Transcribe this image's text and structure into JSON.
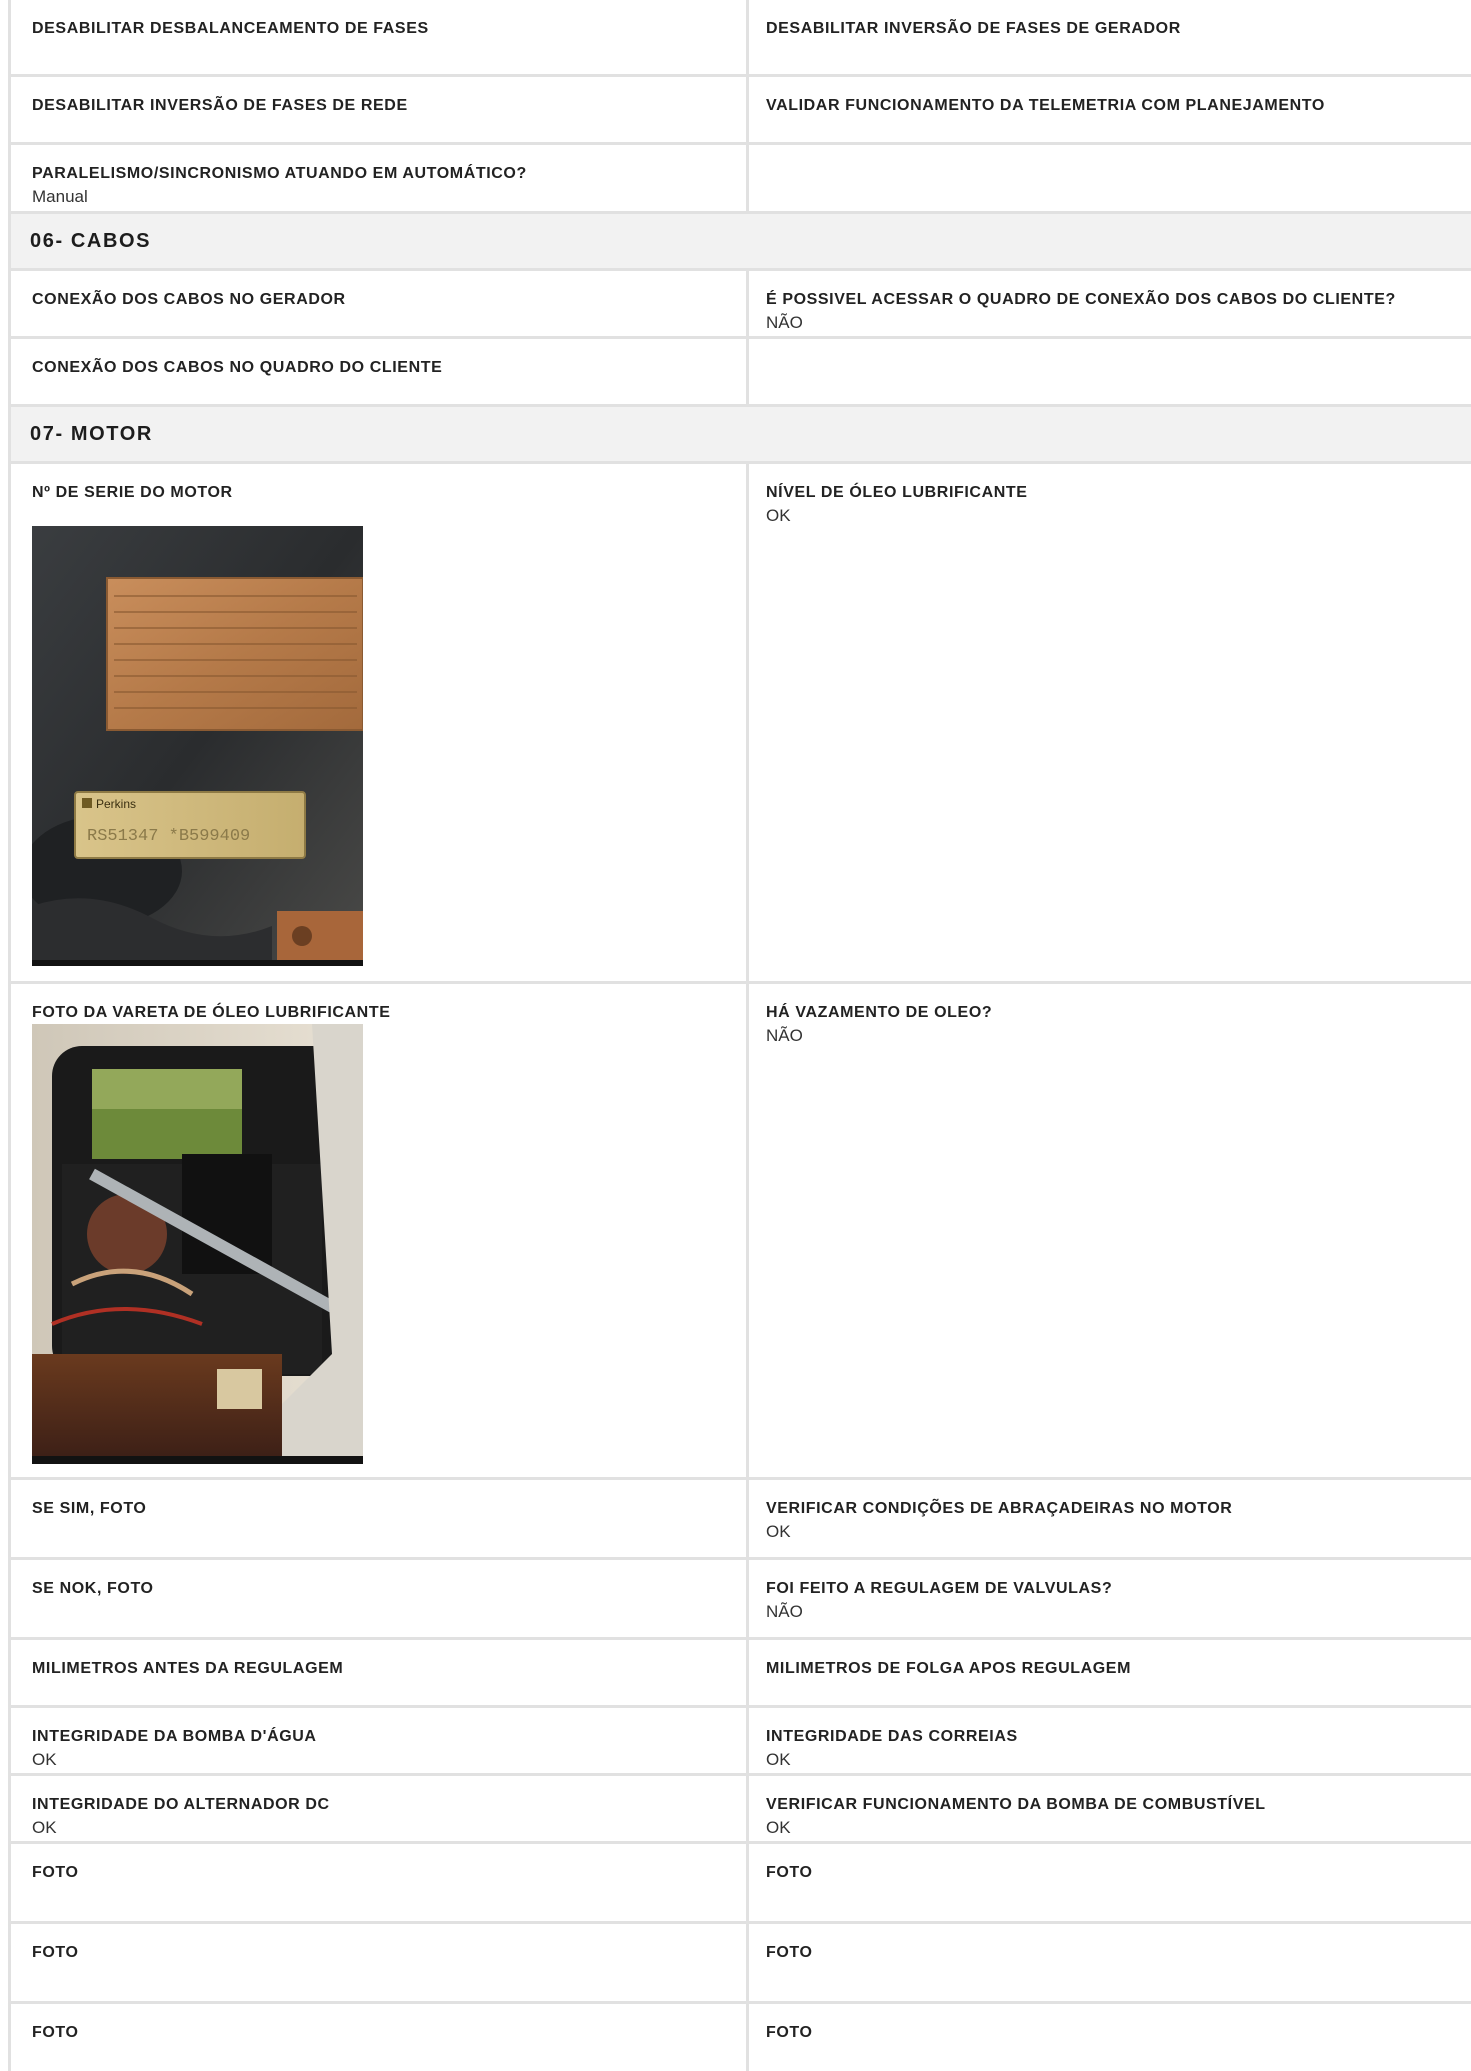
{
  "rows_top": [
    {
      "left": {
        "label": "DESABILITAR DESBALANCEAMENTO DE FASES",
        "value": ""
      },
      "right": {
        "label": "DESABILITAR INVERSÃO DE FASES DE GERADOR",
        "value": ""
      }
    },
    {
      "left": {
        "label": "DESABILITAR INVERSÃO DE FASES DE REDE",
        "value": ""
      },
      "right": {
        "label": "VALIDAR FUNCIONAMENTO DA TELEMETRIA COM PLANEJAMENTO",
        "value": ""
      }
    },
    {
      "left": {
        "label": "PARALELISMO/SINCRONISMO ATUANDO EM AUTOMÁTICO?",
        "value": "Manual"
      },
      "right": {
        "label": "",
        "value": ""
      }
    }
  ],
  "section_cabos": {
    "title": "06- CABOS",
    "rows": [
      {
        "left": {
          "label": "CONEXÃO DOS CABOS NO GERADOR",
          "value": ""
        },
        "right": {
          "label": "É POSSIVEL ACESSAR O QUADRO DE CONEXÃO DOS CABOS DO CLIENTE?",
          "value": "NÃO"
        }
      },
      {
        "left": {
          "label": "CONEXÃO DOS CABOS NO QUADRO DO CLIENTE",
          "value": ""
        },
        "right": {
          "label": "",
          "value": ""
        }
      }
    ]
  },
  "section_motor": {
    "title": "07- MOTOR",
    "serie": {
      "label": "Nº DE SERIE DO MOTOR",
      "plate_brand": "Perkins",
      "plate_text": "RS51347 *B599409"
    },
    "nivel_oleo": {
      "label": "NÍVEL DE ÓLEO LUBRIFICANTE",
      "value": "OK"
    },
    "vareta": {
      "label": "FOTO DA VARETA DE ÓLEO LUBRIFICANTE"
    },
    "vazamento": {
      "label": "HÁ VAZAMENTO DE OLEO?",
      "value": "NÃO"
    },
    "rows": [
      {
        "left": {
          "label": "SE SIM, FOTO",
          "value": ""
        },
        "right": {
          "label": "VERIFICAR CONDIÇÕES DE ABRAÇADEIRAS NO MOTOR",
          "value": "OK"
        }
      },
      {
        "left": {
          "label": "SE NOK, FOTO",
          "value": ""
        },
        "right": {
          "label": "FOI FEITO A REGULAGEM DE VALVULAS?",
          "value": "NÃO"
        }
      },
      {
        "left": {
          "label": "MILIMETROS ANTES DA REGULAGEM",
          "value": ""
        },
        "right": {
          "label": "MILIMETROS DE FOLGA APOS REGULAGEM",
          "value": ""
        }
      },
      {
        "left": {
          "label": "INTEGRIDADE DA BOMBA D'ÁGUA",
          "value": "OK"
        },
        "right": {
          "label": "INTEGRIDADE DAS CORREIAS",
          "value": "OK"
        }
      },
      {
        "left": {
          "label": "INTEGRIDADE DO ALTERNADOR DC",
          "value": "OK"
        },
        "right": {
          "label": "VERIFICAR FUNCIONAMENTO DA BOMBA DE COMBUSTÍVEL",
          "value": "OK"
        }
      },
      {
        "left": {
          "label": "FOTO",
          "value": ""
        },
        "right": {
          "label": "FOTO",
          "value": ""
        }
      },
      {
        "left": {
          "label": "FOTO",
          "value": ""
        },
        "right": {
          "label": "FOTO",
          "value": ""
        }
      },
      {
        "left": {
          "label": "FOTO",
          "value": ""
        },
        "right": {
          "label": "FOTO",
          "value": ""
        }
      }
    ]
  }
}
